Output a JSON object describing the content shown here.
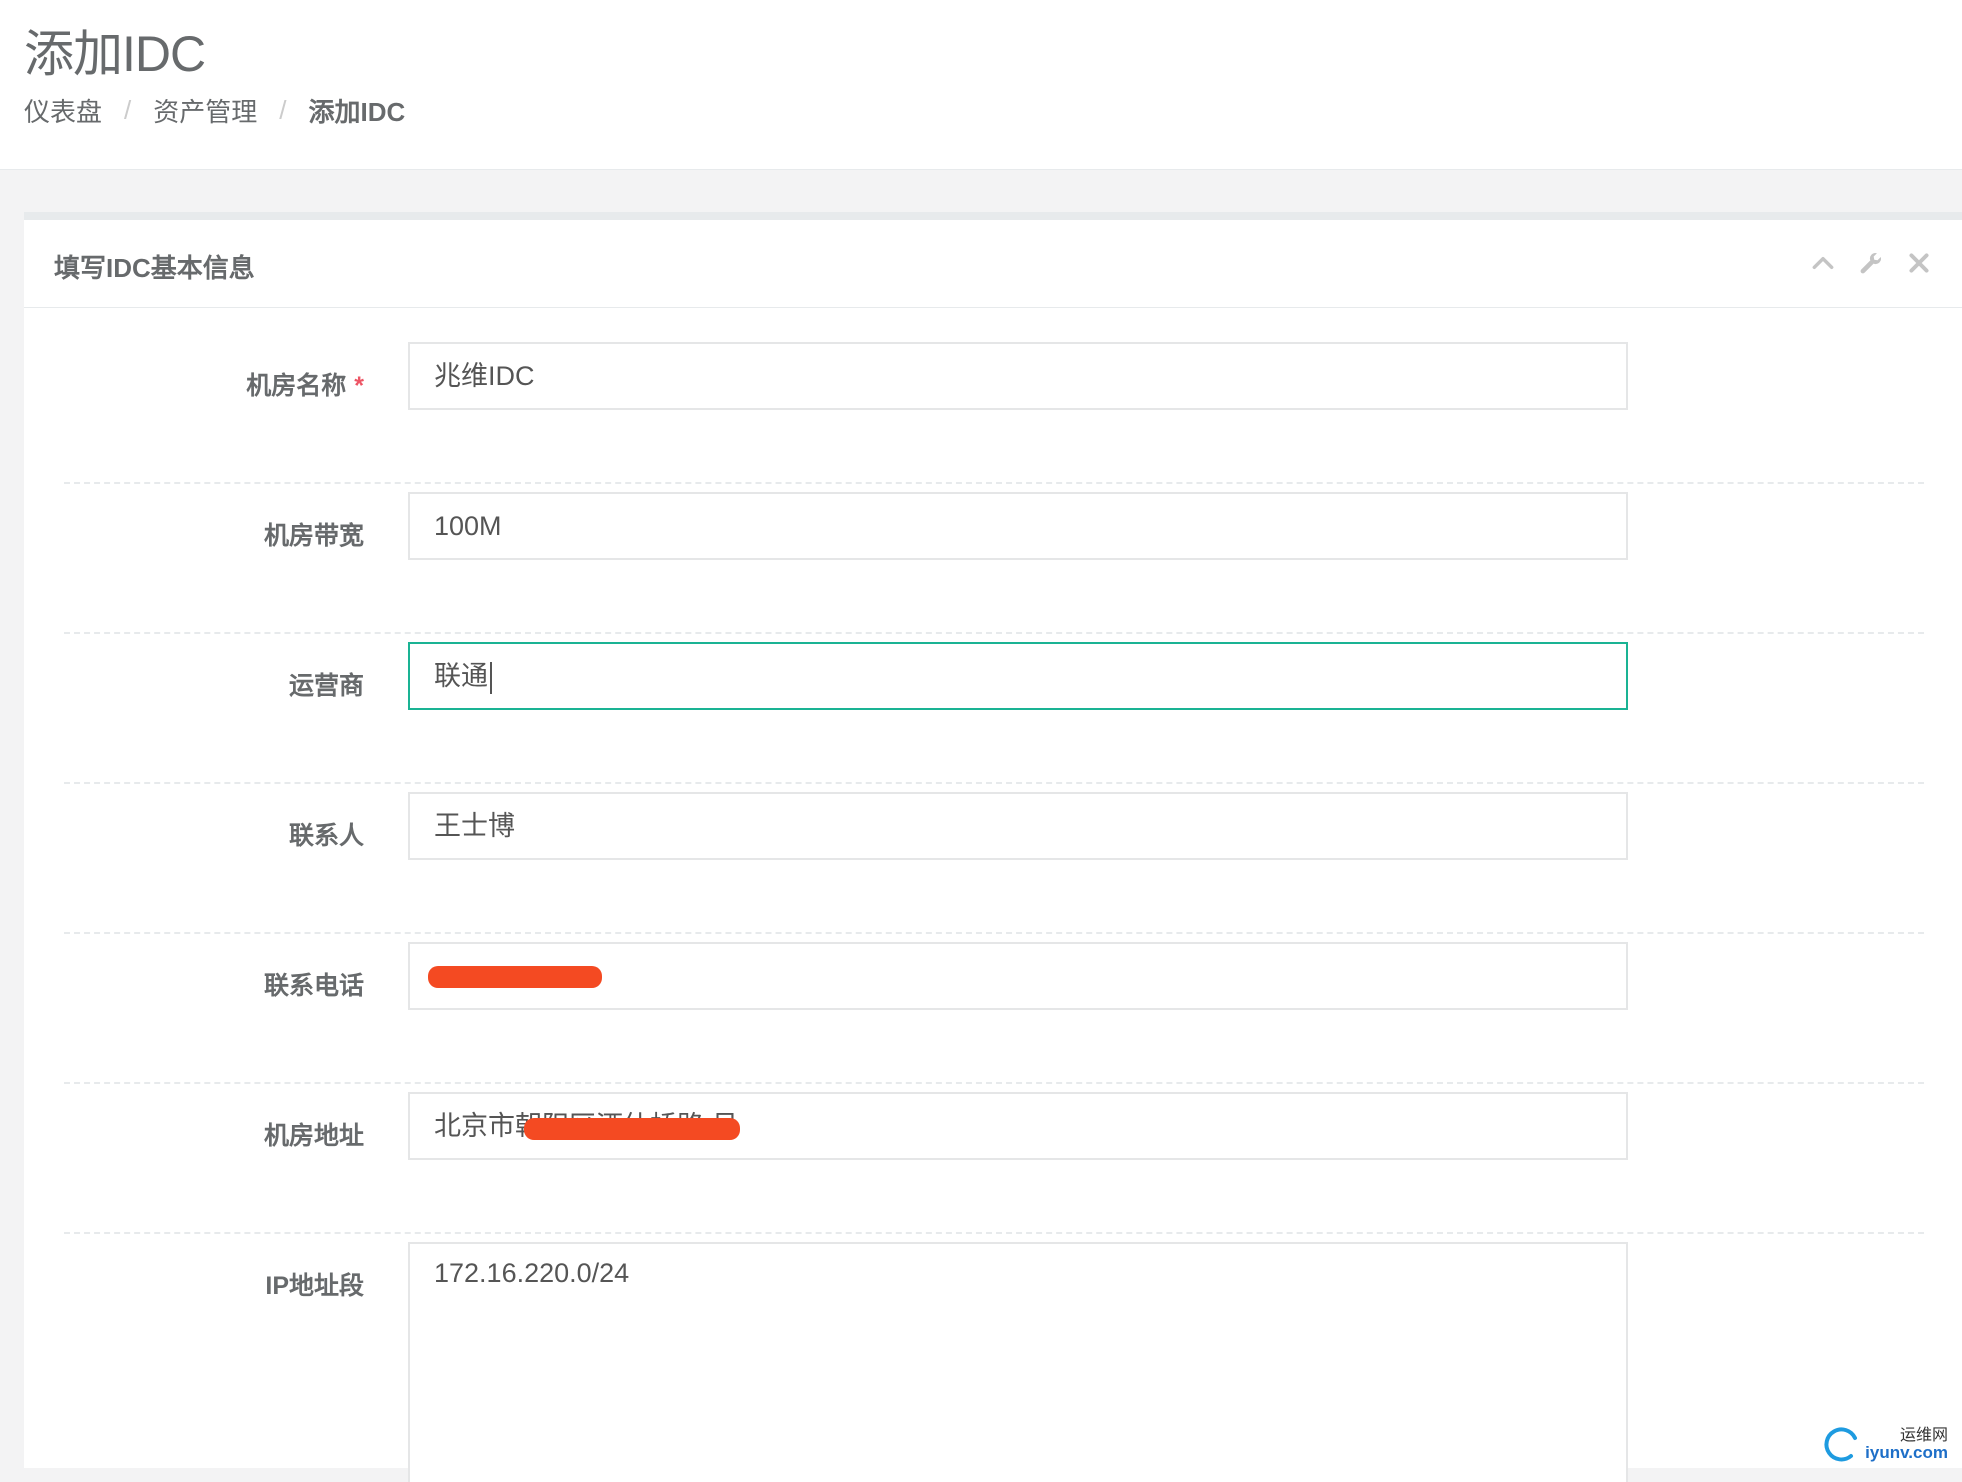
{
  "page": {
    "title": "添加IDC",
    "breadcrumb": [
      "仪表盘",
      "资产管理",
      "添加IDC"
    ]
  },
  "panel": {
    "title": "填写IDC基本信息",
    "tools": [
      "collapse-icon",
      "wrench-icon",
      "close-icon"
    ]
  },
  "form": {
    "name": {
      "label": "机房名称",
      "required": "*",
      "value": "兆维IDC"
    },
    "bandwidth": {
      "label": "机房带宽",
      "value": "100M"
    },
    "operator": {
      "label": "运营商",
      "value": "联通"
    },
    "contact": {
      "label": "联系人",
      "value": "王士博"
    },
    "phone": {
      "label": "联系电话",
      "value": ""
    },
    "address": {
      "label": "机房地址",
      "value": "北京市朝阳区酒仙桥路  号"
    },
    "ip_range": {
      "label": "IP地址段",
      "value": "172.16.220.0/24"
    }
  },
  "colors": {
    "focus_border": "#1ab394",
    "required": "#ed5565",
    "redaction": "#f44a22"
  },
  "watermark": {
    "cn": "运维网",
    "en": "iyunv.com"
  }
}
